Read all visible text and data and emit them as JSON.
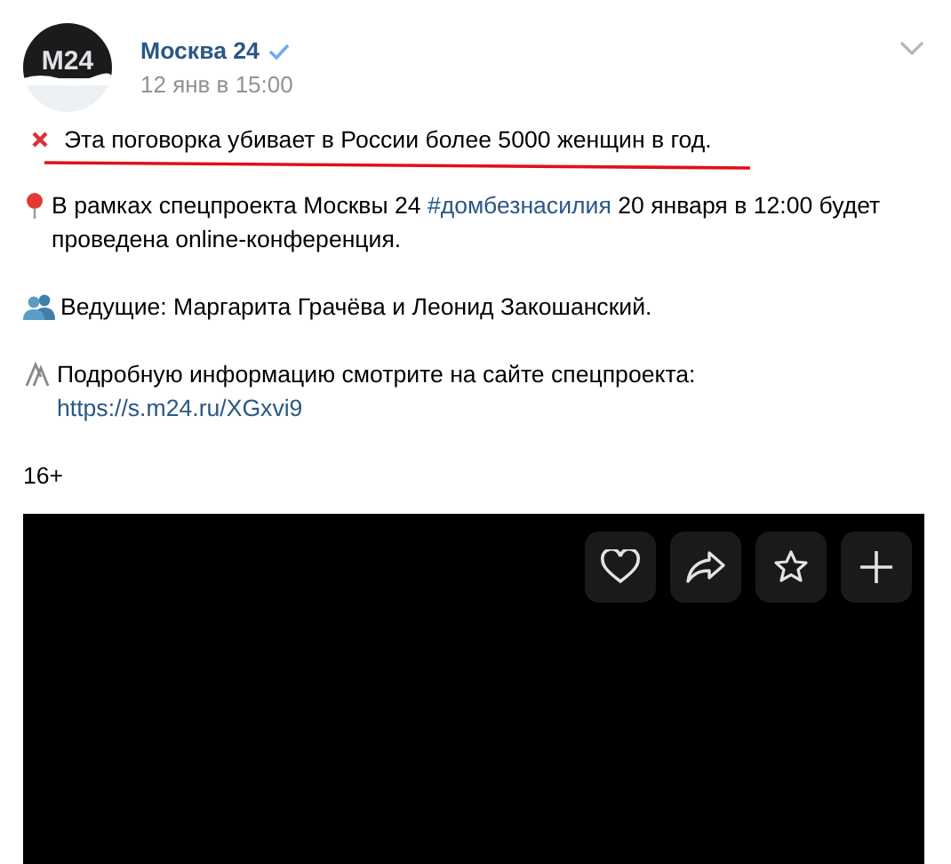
{
  "post": {
    "author": "Москва 24",
    "verified": true,
    "date": "12 янв в 15:00",
    "avatar_text": "M24"
  },
  "headline": {
    "text": "Эта поговорка убивает в России более 5000 женщин в год.",
    "underlined": true
  },
  "paragraphs": [
    {
      "kind": "pin",
      "segments": [
        {
          "kind": "text",
          "text": "В рамках спецпроекта Москвы 24 "
        },
        {
          "kind": "hashtag",
          "text": "#домбезнасилия"
        },
        {
          "kind": "text",
          "text": " 20 января в 12:00 будет проведена online-конференция."
        }
      ]
    },
    {
      "kind": "people",
      "segments": [
        {
          "kind": "text",
          "text": "Ведущие: Маргарита Грачёва и Леонид Закошанский."
        }
      ]
    },
    {
      "kind": "clip",
      "segments": [
        {
          "kind": "text",
          "text": "Подробную информацию смотрите на сайте спецпроекта: "
        },
        {
          "kind": "link",
          "text": "https://s.m24.ru/XGxvi9"
        }
      ]
    },
    {
      "kind": "plain",
      "segments": [
        {
          "kind": "text",
          "text": "16+"
        }
      ]
    }
  ],
  "video": {
    "actions": [
      {
        "kind": "heart"
      },
      {
        "kind": "share"
      },
      {
        "kind": "star"
      },
      {
        "kind": "plus"
      }
    ]
  }
}
